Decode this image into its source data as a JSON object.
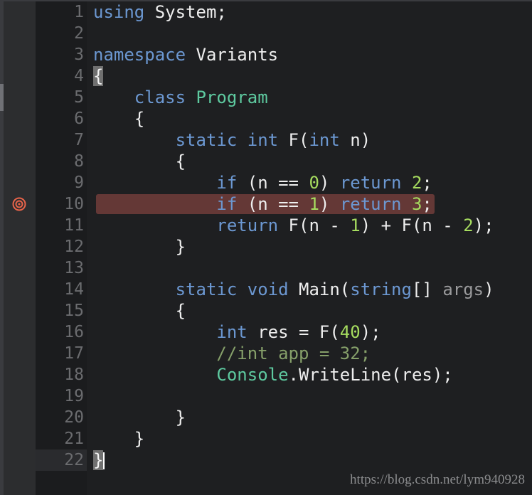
{
  "editor": {
    "breakpoint_line": 10,
    "current_line": 22,
    "colors": {
      "keyword": "#6c98d2",
      "type": "#5ecaa0",
      "number": "#a6dc5f",
      "comment": "#86a06a",
      "parameter": "#9a9a9c",
      "breakpoint": "#e8644a",
      "breakpoint_highlight": "#643836"
    },
    "lines": [
      {
        "num": "1",
        "tokens": [
          [
            "k",
            "using"
          ],
          [
            "x",
            " System;"
          ]
        ]
      },
      {
        "num": "2",
        "tokens": []
      },
      {
        "num": "3",
        "tokens": [
          [
            "k",
            "namespace"
          ],
          [
            "x",
            " Variants"
          ]
        ]
      },
      {
        "num": "4",
        "tokens": [
          [
            "b",
            "{"
          ]
        ]
      },
      {
        "num": "5",
        "tokens": [
          [
            "x",
            "    "
          ],
          [
            "k",
            "class"
          ],
          [
            "x",
            " "
          ],
          [
            "t",
            "Program"
          ]
        ]
      },
      {
        "num": "6",
        "tokens": [
          [
            "x",
            "    {"
          ]
        ]
      },
      {
        "num": "7",
        "tokens": [
          [
            "x",
            "        "
          ],
          [
            "k",
            "static int"
          ],
          [
            "x",
            " F("
          ],
          [
            "k",
            "int"
          ],
          [
            "x",
            " n)"
          ]
        ]
      },
      {
        "num": "8",
        "tokens": [
          [
            "x",
            "        {"
          ]
        ]
      },
      {
        "num": "9",
        "tokens": [
          [
            "x",
            "            "
          ],
          [
            "k",
            "if"
          ],
          [
            "x",
            " (n == "
          ],
          [
            "n",
            "0"
          ],
          [
            "x",
            ") "
          ],
          [
            "k",
            "return"
          ],
          [
            "x",
            " "
          ],
          [
            "n",
            "2"
          ],
          [
            "x",
            ";"
          ]
        ]
      },
      {
        "num": "10",
        "tokens": [
          [
            "x",
            "            "
          ],
          [
            "k",
            "if"
          ],
          [
            "x",
            " (n == "
          ],
          [
            "n",
            "1"
          ],
          [
            "x",
            ") "
          ],
          [
            "k",
            "return"
          ],
          [
            "x",
            " "
          ],
          [
            "n",
            "3"
          ],
          [
            "x",
            ";"
          ]
        ]
      },
      {
        "num": "11",
        "tokens": [
          [
            "x",
            "            "
          ],
          [
            "k",
            "return"
          ],
          [
            "x",
            " F(n - "
          ],
          [
            "n",
            "1"
          ],
          [
            "x",
            ") + F(n - "
          ],
          [
            "n",
            "2"
          ],
          [
            "x",
            ");"
          ]
        ]
      },
      {
        "num": "12",
        "tokens": [
          [
            "x",
            "        }"
          ]
        ]
      },
      {
        "num": "13",
        "tokens": []
      },
      {
        "num": "14",
        "tokens": [
          [
            "x",
            "        "
          ],
          [
            "k",
            "static void"
          ],
          [
            "x",
            " Main("
          ],
          [
            "k",
            "string"
          ],
          [
            "x",
            "[] "
          ],
          [
            "p",
            "args"
          ],
          [
            "x",
            ")"
          ]
        ]
      },
      {
        "num": "15",
        "tokens": [
          [
            "x",
            "        {"
          ]
        ]
      },
      {
        "num": "16",
        "tokens": [
          [
            "x",
            "            "
          ],
          [
            "k",
            "int"
          ],
          [
            "x",
            " res = F("
          ],
          [
            "n",
            "40"
          ],
          [
            "x",
            ");"
          ]
        ]
      },
      {
        "num": "17",
        "tokens": [
          [
            "x",
            "            "
          ],
          [
            "c",
            "//int app = 32;"
          ]
        ]
      },
      {
        "num": "18",
        "tokens": [
          [
            "x",
            "            "
          ],
          [
            "t",
            "Console"
          ],
          [
            "x",
            ".WriteLine(res);"
          ]
        ]
      },
      {
        "num": "19",
        "tokens": []
      },
      {
        "num": "20",
        "tokens": [
          [
            "x",
            "        }"
          ]
        ]
      },
      {
        "num": "21",
        "tokens": [
          [
            "x",
            "    }"
          ]
        ]
      },
      {
        "num": "22",
        "tokens": [
          [
            "b",
            "}"
          ]
        ]
      }
    ]
  },
  "watermark": "https://blog.csdn.net/lym940928"
}
